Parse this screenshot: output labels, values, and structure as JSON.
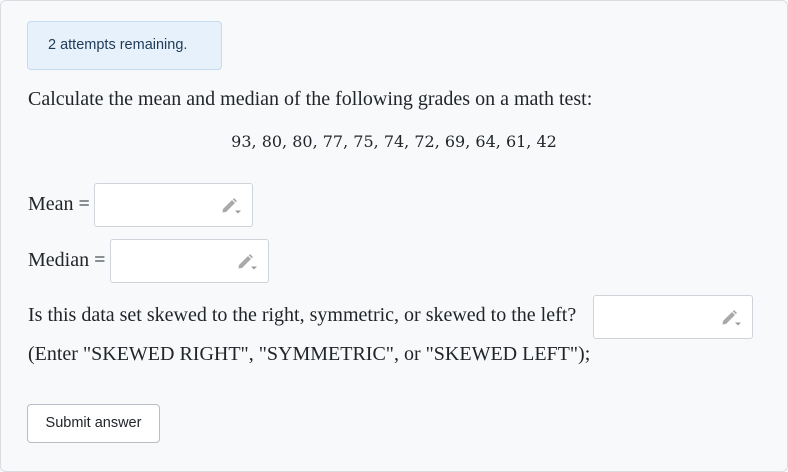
{
  "attempts": {
    "text": "2 attempts remaining."
  },
  "question": {
    "prompt": "Calculate the mean and median of the following grades on a math test:",
    "grades_text": "93,  80,  80,  77,  75,  74,  72,  69,  64,  61,  42"
  },
  "fields": {
    "mean_label": "Mean =",
    "mean_value": "",
    "median_label": "Median =",
    "median_value": "",
    "skew_question": "Is this data set skewed to the right, symmetric, or skewed to the left?",
    "skew_value": "",
    "skew_hint": "(Enter \"SKEWED RIGHT\", \"SYMMETRIC\", or \"SKEWED LEFT\");"
  },
  "actions": {
    "submit_label": "Submit answer"
  },
  "icons": {
    "edit": "pencil-icon"
  }
}
